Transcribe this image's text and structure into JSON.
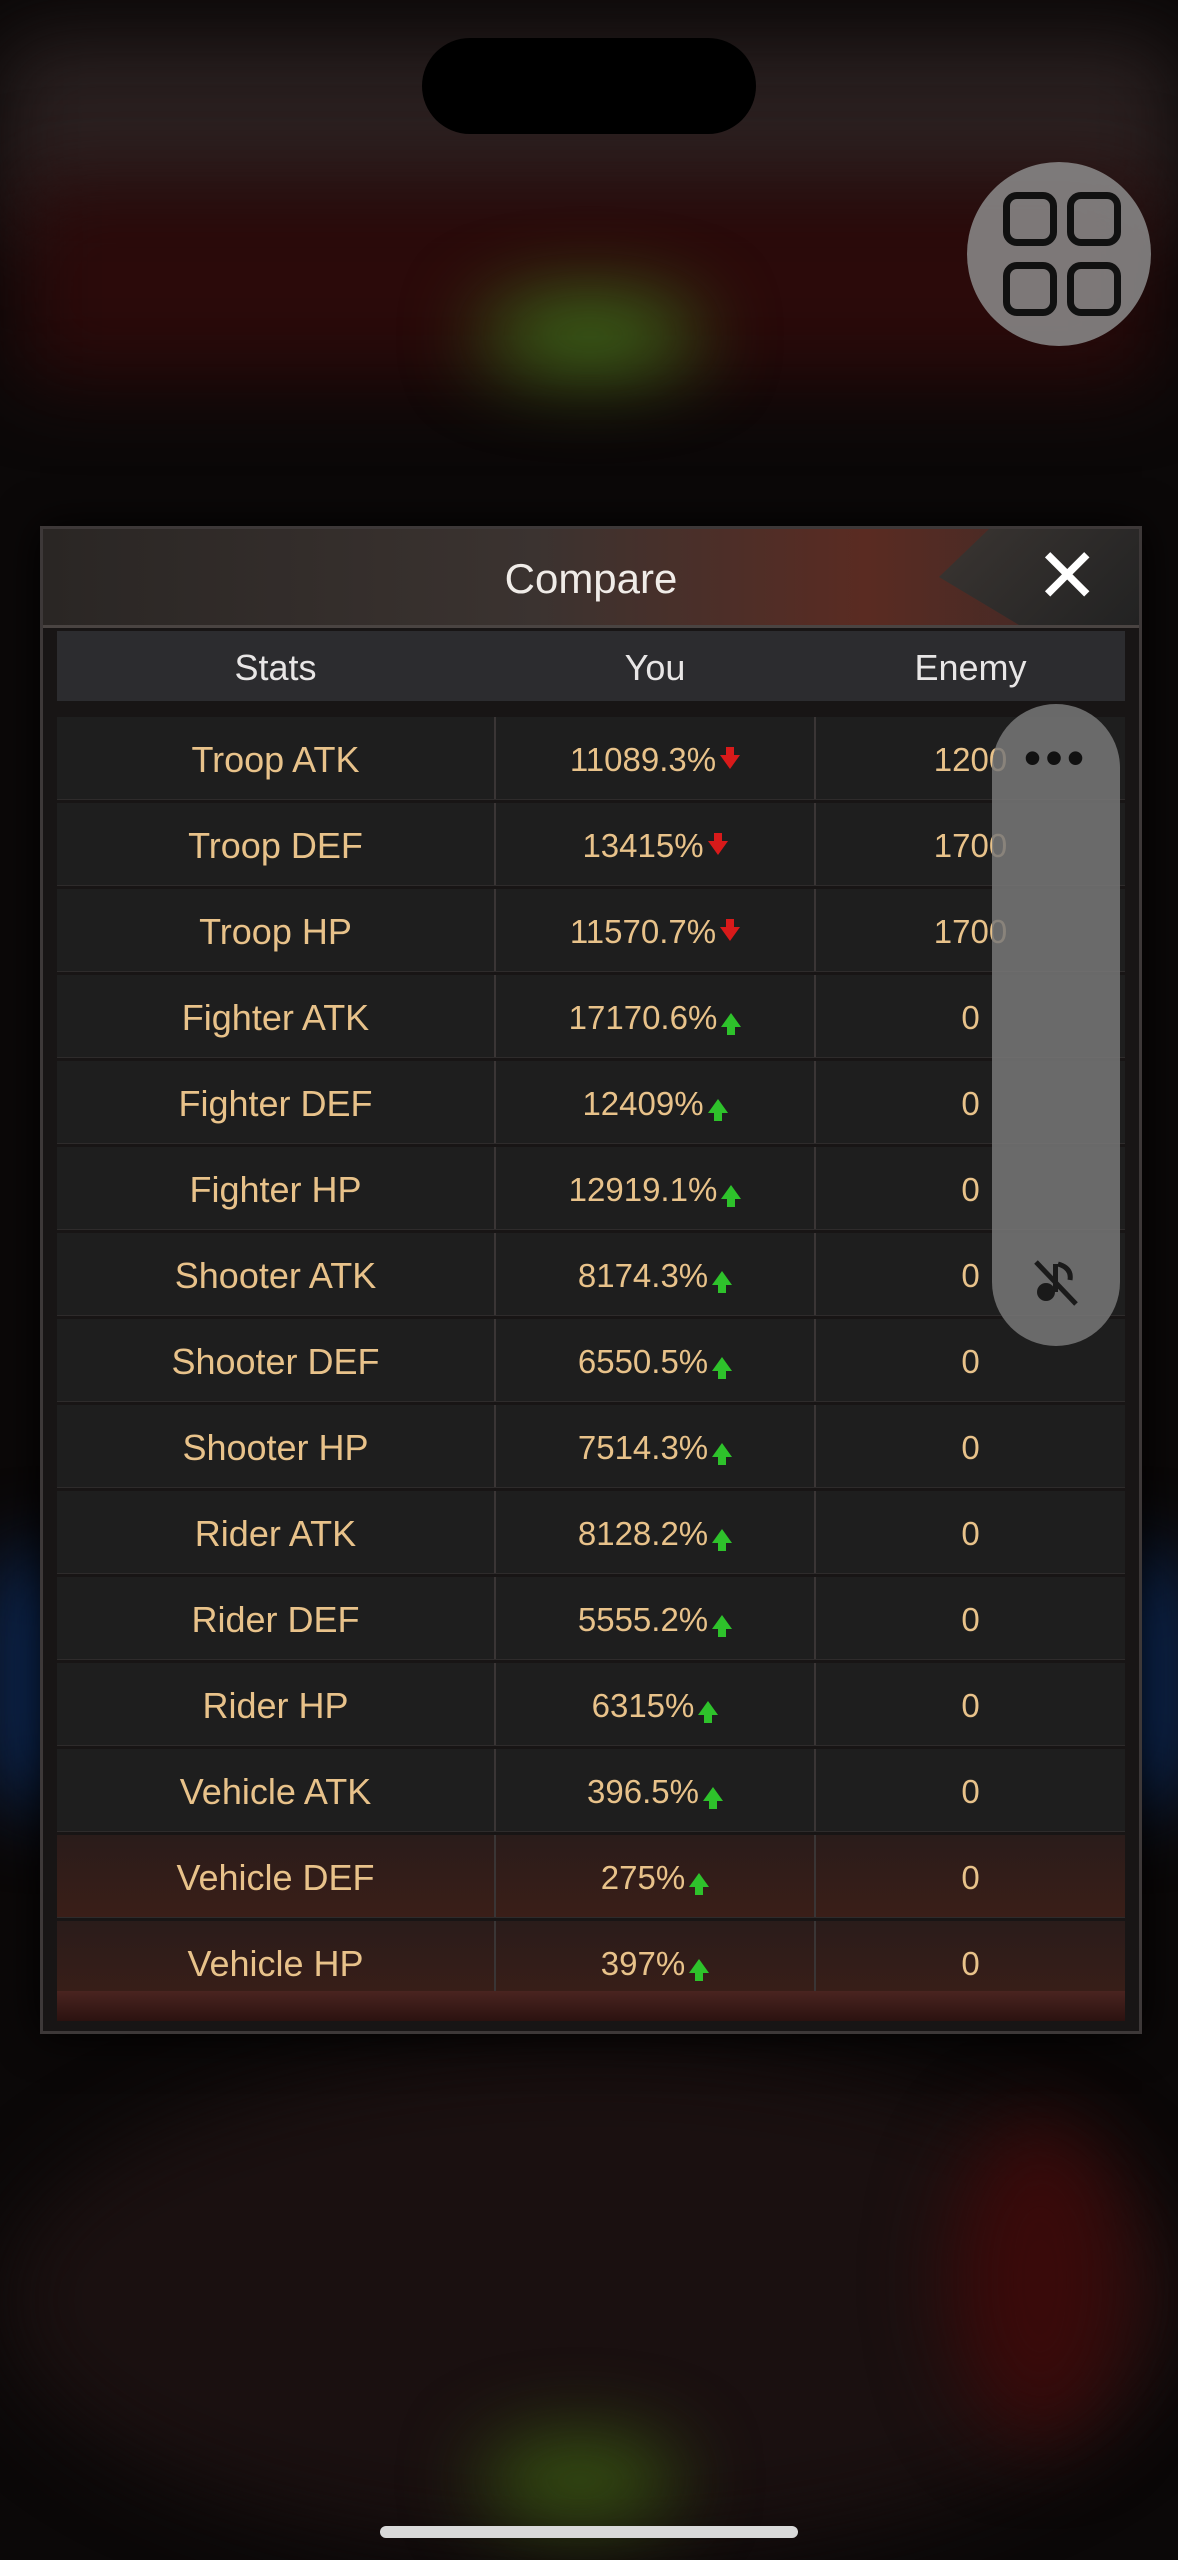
{
  "dialog": {
    "title": "Compare",
    "close_label": "✕"
  },
  "table": {
    "headers": [
      "Stats",
      "You",
      "Enemy"
    ],
    "rows": [
      {
        "stat": "Troop ATK",
        "you": "11089.3%",
        "trend": "down",
        "enemy": "1200"
      },
      {
        "stat": "Troop DEF",
        "you": "13415%",
        "trend": "down",
        "enemy": "1700"
      },
      {
        "stat": "Troop HP",
        "you": "11570.7%",
        "trend": "down",
        "enemy": "1700"
      },
      {
        "stat": "Fighter ATK",
        "you": "17170.6%",
        "trend": "up",
        "enemy": "0"
      },
      {
        "stat": "Fighter DEF",
        "you": "12409%",
        "trend": "up",
        "enemy": "0"
      },
      {
        "stat": "Fighter HP",
        "you": "12919.1%",
        "trend": "up",
        "enemy": "0"
      },
      {
        "stat": "Shooter ATK",
        "you": "8174.3%",
        "trend": "up",
        "enemy": "0"
      },
      {
        "stat": "Shooter DEF",
        "you": "6550.5%",
        "trend": "up",
        "enemy": "0"
      },
      {
        "stat": "Shooter HP",
        "you": "7514.3%",
        "trend": "up",
        "enemy": "0"
      },
      {
        "stat": "Rider ATK",
        "you": "8128.2%",
        "trend": "up",
        "enemy": "0"
      },
      {
        "stat": "Rider DEF",
        "you": "5555.2%",
        "trend": "up",
        "enemy": "0"
      },
      {
        "stat": "Rider HP",
        "you": "6315%",
        "trend": "up",
        "enemy": "0"
      },
      {
        "stat": "Vehicle ATK",
        "you": "396.5%",
        "trend": "up",
        "enemy": "0"
      },
      {
        "stat": "Vehicle DEF",
        "you": "275%",
        "trend": "up",
        "enemy": "0"
      },
      {
        "stat": "Vehicle HP",
        "you": "397%",
        "trend": "up",
        "enemy": "0"
      }
    ]
  },
  "overlay": {
    "more_label": "•••",
    "assistive_icon": "grid-icon",
    "mute_icon": "music-off-icon"
  },
  "colors": {
    "stat_text": "#e8c28a",
    "up_arrow": "#2ec22b",
    "down_arrow": "#d81a1a"
  }
}
